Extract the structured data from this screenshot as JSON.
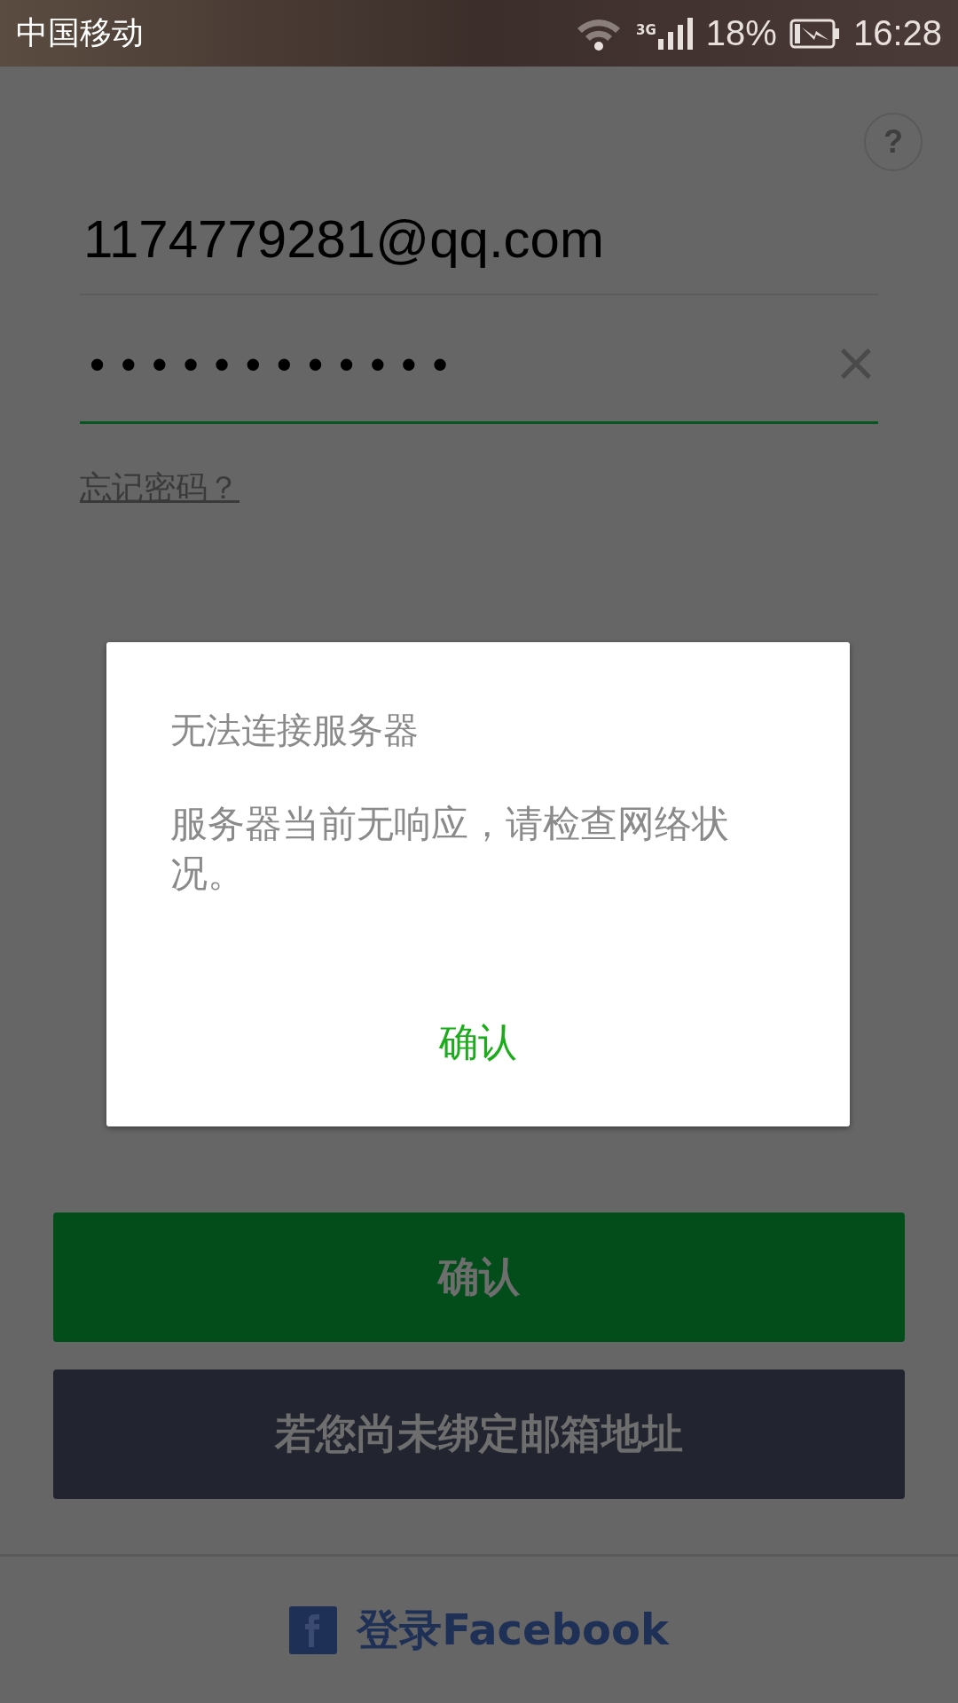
{
  "status_bar": {
    "carrier": "中国移动",
    "network": "3G",
    "battery": "18%",
    "time": "16:28"
  },
  "help": {
    "label": "?"
  },
  "email_field": {
    "value": "1174779281@qq.com",
    "focused": false
  },
  "password_field": {
    "value": "••••••••••••",
    "focused": true,
    "clear": "×"
  },
  "forgot_link": "忘记密码？",
  "confirm_button": "确认",
  "bind_email_button": "若您尚未绑定邮箱地址",
  "facebook_login": "登录Facebook",
  "dialog": {
    "title": "无法连接服务器",
    "message": "服务器当前无响应，请检查网络状况。",
    "ok_button": "确认"
  }
}
